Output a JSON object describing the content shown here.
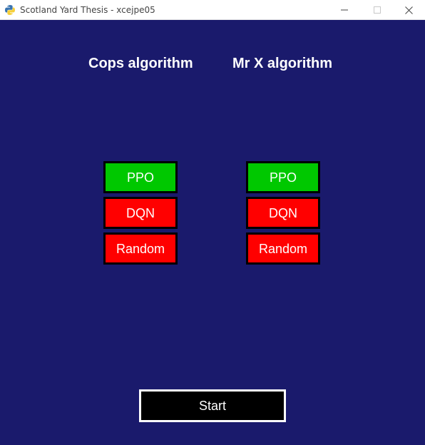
{
  "window": {
    "title": "Scotland Yard Thesis - xcejpe05",
    "app_icon": "python-icon",
    "controls": {
      "minimize_icon": "minimize-icon",
      "maximize_icon": "maximize-icon",
      "close_icon": "close-icon"
    }
  },
  "cops": {
    "heading": "Cops algorithm",
    "options": [
      {
        "label": "PPO",
        "selected": true
      },
      {
        "label": "DQN",
        "selected": false
      },
      {
        "label": "Random",
        "selected": false
      }
    ]
  },
  "mrx": {
    "heading": "Mr X algorithm",
    "options": [
      {
        "label": "PPO",
        "selected": true
      },
      {
        "label": "DQN",
        "selected": false
      },
      {
        "label": "Random",
        "selected": false
      }
    ]
  },
  "start": {
    "label": "Start"
  },
  "colors": {
    "background": "#1a1a6c",
    "selected": "#00c800",
    "unselected": "#ff0000",
    "start_bg": "#000000",
    "start_border": "#ffffff"
  }
}
